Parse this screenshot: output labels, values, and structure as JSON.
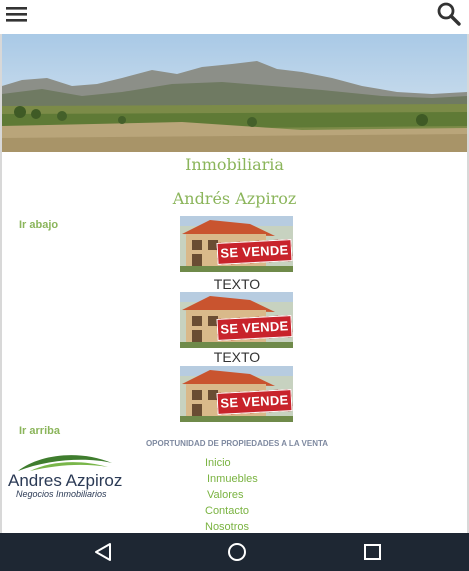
{
  "header": {
    "menu_icon": "hamburger-menu-icon",
    "search_icon": "search-icon"
  },
  "titles": {
    "line1": "Inmobiliaria",
    "line2": "Andrés Azpiroz"
  },
  "links": {
    "ir_abajo": "Ir abajo",
    "ir_arriba": "Ir arriba"
  },
  "properties": [
    {
      "badge": "SE VENDE",
      "caption": "TEXTO"
    },
    {
      "badge": "SE VENDE",
      "caption": "TEXTO"
    },
    {
      "badge": "SE VENDE",
      "caption": ""
    }
  ],
  "banner": "OPORTUNIDAD DE PROPIEDADES A LA VENTA",
  "logo": {
    "name": "Andres Azpiroz",
    "tagline": "Negocios Inmobiliarios"
  },
  "footer_nav": [
    "Inicio",
    "Inmuebles",
    "Valores",
    "Contacto",
    "Nosotros"
  ],
  "android_nav": {
    "back_icon": "back-triangle-icon",
    "home_icon": "home-circle-icon",
    "recent_icon": "recent-apps-square-icon"
  },
  "colors": {
    "accent_green": "#8bb55b",
    "link_green": "#7ab341",
    "badge_red": "#c8232b",
    "navbar": "#1e2733"
  }
}
